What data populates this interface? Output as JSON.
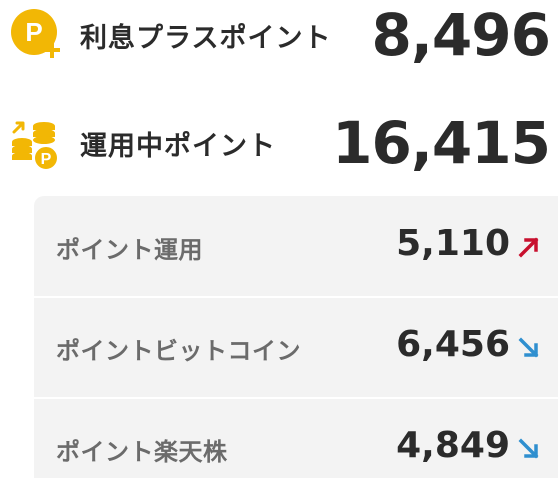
{
  "summary": {
    "interest_points": {
      "label": "利息プラスポイント",
      "value": "8,496",
      "icon": "p-plus-coin-icon"
    },
    "invested_points": {
      "label": "運用中ポイント",
      "value": "16,415",
      "icon": "coin-stack-up-icon"
    }
  },
  "breakdown": [
    {
      "label": "ポイント運用",
      "value": "5,110",
      "trend": "up",
      "trend_color": "#c8102e"
    },
    {
      "label": "ポイントビットコイン",
      "value": "6,456",
      "trend": "down",
      "trend_color": "#2f8fcf"
    },
    {
      "label": "ポイント楽天株",
      "value": "4,849",
      "trend": "down",
      "trend_color": "#2f8fcf"
    }
  ],
  "colors": {
    "coin_gold": "#f2b705",
    "text_dark": "#2b2b2b",
    "text_muted": "#6b6b6b",
    "panel_bg": "#f3f3f3"
  }
}
